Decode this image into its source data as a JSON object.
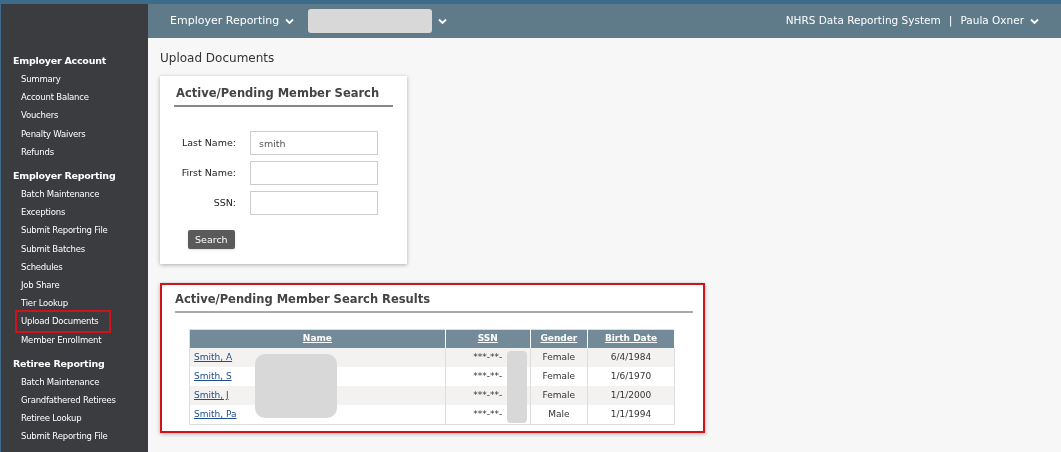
{
  "sidebar": {
    "sections": [
      {
        "title": "Employer Account",
        "items": [
          {
            "label": "Summary",
            "highlighted": false
          },
          {
            "label": "Account Balance",
            "highlighted": false
          },
          {
            "label": "Vouchers",
            "highlighted": false
          },
          {
            "label": "Penalty Waivers",
            "highlighted": false
          },
          {
            "label": "Refunds",
            "highlighted": false
          }
        ]
      },
      {
        "title": "Employer Reporting",
        "items": [
          {
            "label": "Batch Maintenance",
            "highlighted": false
          },
          {
            "label": "Exceptions",
            "highlighted": false
          },
          {
            "label": "Submit Reporting File",
            "highlighted": false
          },
          {
            "label": "Submit Batches",
            "highlighted": false
          },
          {
            "label": "Schedules",
            "highlighted": false
          },
          {
            "label": "Job Share",
            "highlighted": false
          },
          {
            "label": "Tier Lookup",
            "highlighted": false
          },
          {
            "label": "Upload Documents",
            "highlighted": true
          },
          {
            "label": "Member Enrollment",
            "highlighted": false
          }
        ]
      },
      {
        "title": "Retiree Reporting",
        "items": [
          {
            "label": "Batch Maintenance",
            "highlighted": false
          },
          {
            "label": "Grandfathered Retirees",
            "highlighted": false
          },
          {
            "label": "Retiree Lookup",
            "highlighted": false
          },
          {
            "label": "Submit Reporting File",
            "highlighted": false
          }
        ]
      }
    ]
  },
  "top_bar": {
    "menu": "Employer Reporting",
    "system": "NHRS Data Reporting System",
    "separator": "|",
    "user": "Paula Oxner"
  },
  "page_title": "Upload Documents",
  "search_card": {
    "title": "Active/Pending Member Search",
    "fields": [
      {
        "label": "Last Name:",
        "value": "smith"
      },
      {
        "label": "First Name:"
      },
      {
        "label": "SSN:"
      }
    ],
    "button": "Search"
  },
  "results_card": {
    "title": "Active/Pending Member Search Results",
    "highlighted": true,
    "columns": [
      "Name",
      "SSN",
      "Gender",
      "Birth Date"
    ],
    "rows": [
      [
        "Smith, A",
        "***-**-",
        "Female",
        "6/4/1984"
      ],
      [
        "Smith, S",
        "***-**-",
        "Female",
        "1/6/1970"
      ],
      [
        "Smith, J",
        "***-**-",
        "Female",
        "1/1/2000"
      ],
      [
        "Smith, Pa",
        "***-**-",
        "Male",
        "1/1/1994"
      ]
    ]
  }
}
